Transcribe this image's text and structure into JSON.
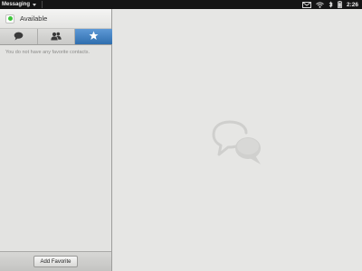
{
  "statusbar": {
    "app_name": "Messaging",
    "time": "2:26",
    "icons": [
      "email-icon",
      "wifi-icon",
      "bluetooth-icon",
      "battery-icon"
    ]
  },
  "sidebar": {
    "status": {
      "label": "Available",
      "color": "#3ec43b"
    },
    "tabs": [
      {
        "name": "conversations",
        "icon": "chat-bubble-icon",
        "active": false
      },
      {
        "name": "buddies",
        "icon": "people-icon",
        "active": false
      },
      {
        "name": "favorites",
        "icon": "star-icon",
        "active": true
      }
    ],
    "empty_message": "You do not have any favorite contacts.",
    "footer": {
      "add_favorite_label": "Add Favorite"
    }
  },
  "main": {
    "placeholder_icon": "chat-bubbles-logo"
  },
  "colors": {
    "active_tab": "#3a7bbf",
    "available": "#3ec43b"
  }
}
